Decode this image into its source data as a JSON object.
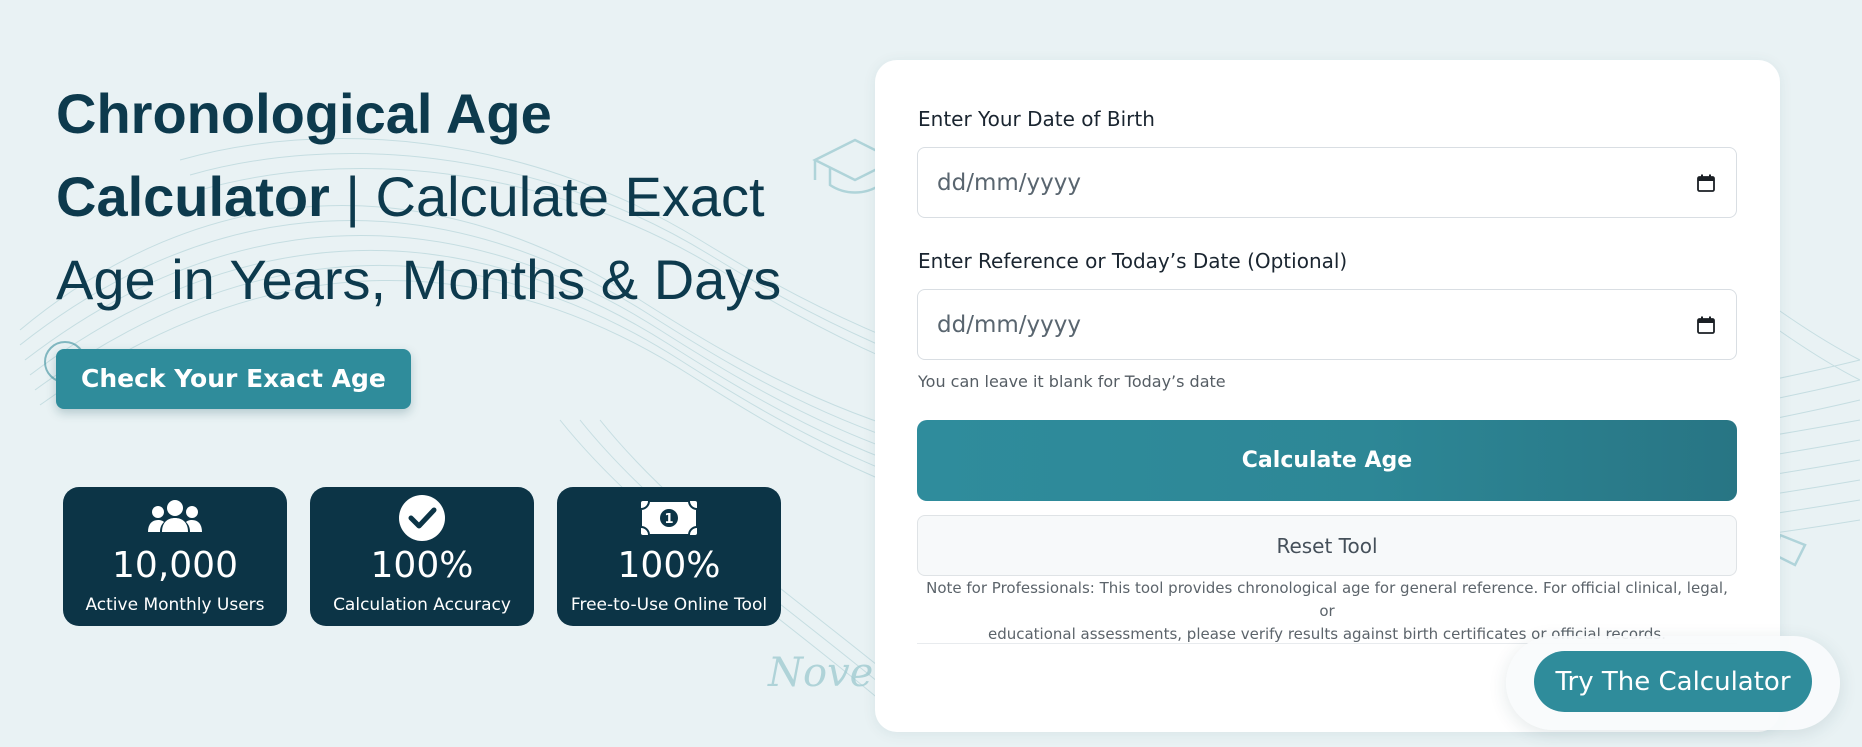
{
  "hero": {
    "title_bold_1": "Chronological Age",
    "title_bold_2": "Calculator",
    "title_separator": " | ",
    "title_rest_1": "Calculate Exact",
    "title_rest_2": "Age in Years, Months & Days",
    "cta_label": "Check Your Exact Age"
  },
  "stats": [
    {
      "icon": "users-icon",
      "value": "10,000",
      "label": "Active Monthly Users"
    },
    {
      "icon": "check-circle-icon",
      "value": "100%",
      "label": "Calculation Accuracy"
    },
    {
      "icon": "money-bill-icon",
      "value": "100%",
      "label": "Free-to-Use Online Tool"
    }
  ],
  "form": {
    "dob_label": "Enter Your Date of Birth",
    "dob_placeholder": "dd/mm/yyyy",
    "ref_label": "Enter Reference or Today’s Date (Optional)",
    "ref_placeholder": "dd/mm/yyyy",
    "hint": "You can leave it blank for Today’s date",
    "calculate_label": "Calculate Age",
    "reset_label": "Reset Tool",
    "note_line_1": "Note for Professionals: This tool provides chronological age for general reference. For official clinical, legal, or",
    "note_line_2": "educational assessments, please verify results against birth certificates or official records."
  },
  "floating": {
    "try_label": "Try The Calculator"
  },
  "background": {
    "script_text": "Noven"
  },
  "colors": {
    "background": "#e9f2f4",
    "dark_teal": "#0c3446",
    "accent_teal": "#2f8c9b",
    "title": "#0d3a4d"
  }
}
